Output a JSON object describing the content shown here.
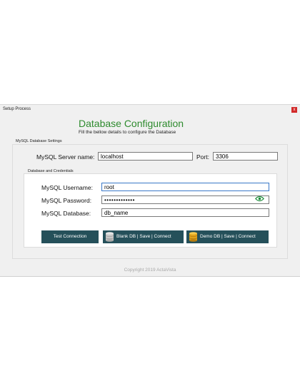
{
  "window": {
    "title": "Setup Process",
    "close_label": "x"
  },
  "header": {
    "title": "Database Configuration",
    "subtitle": "Fill the bellow details to configure the Database"
  },
  "server_group": {
    "legend": "MySQL Database Settings",
    "server_name_label": "MySQL Server name:",
    "server_name_value": "localhost",
    "port_label": "Port:",
    "port_value": "3306"
  },
  "credentials_group": {
    "legend": "Database and Credentials",
    "username_label": "MySQL Username:",
    "username_value": "root",
    "password_label": "MySQL Password:",
    "password_value": "•••••••••••••",
    "database_label": "MySQL Database:",
    "database_value": "db_name"
  },
  "buttons": {
    "test_label": "Test Connection",
    "blank_label": "Blank DB | Save | Connect",
    "demo_label": "Demo DB | Save | Connect"
  },
  "footer": {
    "copyright": "Copyright 2019 ActaVista"
  },
  "colors": {
    "title_green": "#2e8b2e",
    "button_bg": "#25505a",
    "close_red": "#d22a2a",
    "eye_green": "#1e8c3a"
  },
  "icons": [
    "close-icon",
    "eye-icon",
    "database-icon"
  ]
}
